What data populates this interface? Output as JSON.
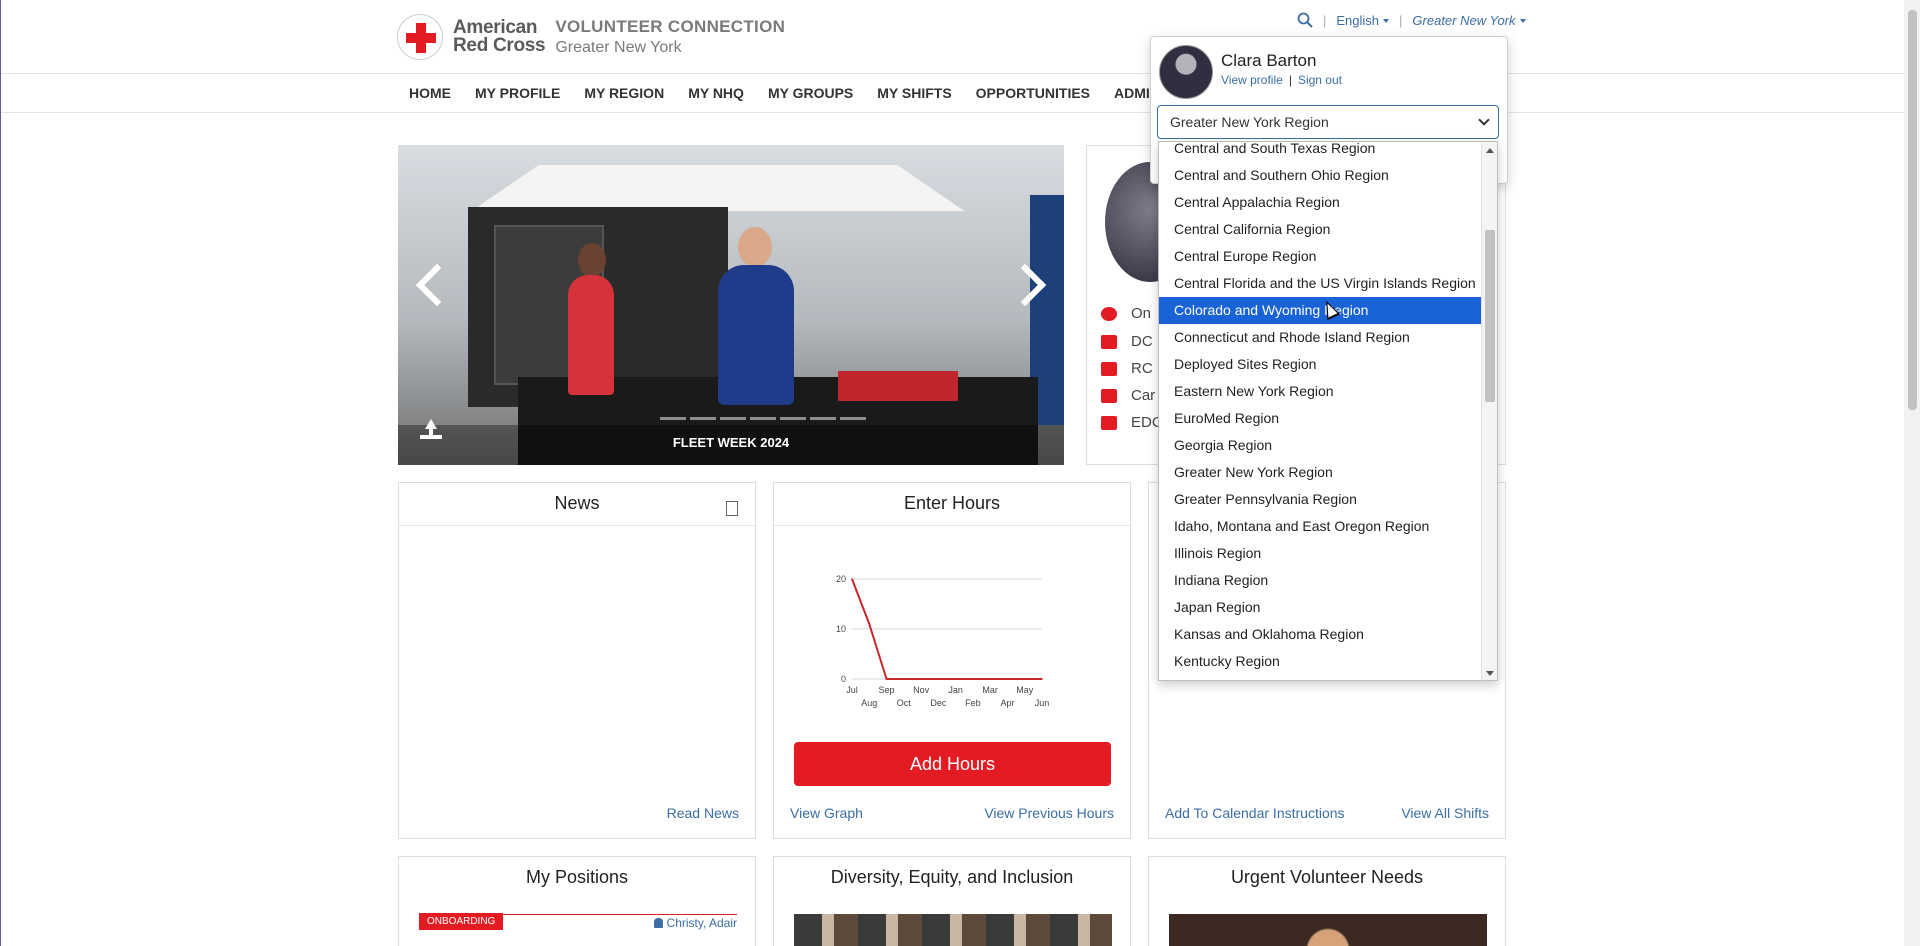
{
  "header": {
    "logo_line1": "American",
    "logo_line2": "Red Cross",
    "app_name": "VOLUNTEER CONNECTION",
    "region_name": "Greater New York",
    "language": "English",
    "region_switcher": "Greater New York"
  },
  "nav": {
    "items": [
      "HOME",
      "MY PROFILE",
      "MY REGION",
      "MY NHQ",
      "MY GROUPS",
      "MY SHIFTS",
      "OPPORTUNITIES",
      "ADMIN"
    ]
  },
  "carousel": {
    "caption": "FLEET WEEK 2024"
  },
  "profile_card": {
    "rows": [
      "On",
      "DC",
      "RC",
      "Car",
      "EDC"
    ]
  },
  "news": {
    "title": "News",
    "link": "Read News"
  },
  "hours": {
    "title": "Enter Hours",
    "button": "Add Hours",
    "link_graph": "View Graph",
    "link_previous": "View Previous Hours"
  },
  "shifts": {
    "link_calendar": "Add To Calendar Instructions",
    "link_all": "View All Shifts"
  },
  "positions": {
    "title": "My Positions",
    "badge": "ONBOARDING",
    "user": "Christy, Adair"
  },
  "dei": {
    "title": "Diversity, Equity, and Inclusion"
  },
  "urgent": {
    "title": "Urgent Volunteer Needs"
  },
  "popover": {
    "name": "Clara Barton",
    "view_profile": "View profile",
    "separator": "|",
    "sign_out": "Sign out",
    "selected_region": "Greater New York Region"
  },
  "region_dropdown": {
    "items": [
      "Central and South Texas Region",
      "Central and Southern Ohio Region",
      "Central Appalachia Region",
      "Central California Region",
      "Central Europe Region",
      "Central Florida and the US Virgin Islands Region",
      "Colorado and Wyoming Region",
      "Connecticut and Rhode Island Region",
      "Deployed Sites Region",
      "Eastern New York Region",
      "EuroMed Region",
      "Georgia Region",
      "Greater New York Region",
      "Greater Pennsylvania Region",
      "Idaho, Montana and East Oregon Region",
      "Illinois Region",
      "Indiana Region",
      "Japan Region",
      "Kansas and Oklahoma Region",
      "Kentucky Region",
      "Kentucky Region"
    ],
    "highlighted": "Colorado and Wyoming Region"
  },
  "colors": {
    "brand_red": "#e31b23",
    "link_blue": "#3b6ea5",
    "highlight_blue": "#1a63d6"
  },
  "chart_data": {
    "type": "line",
    "x_ticks_top": [
      "Jul",
      "Sep",
      "Nov",
      "Jan",
      "Mar",
      "May"
    ],
    "x_ticks_bottom": [
      "Aug",
      "Oct",
      "Dec",
      "Feb",
      "Apr",
      "Jun"
    ],
    "categories": [
      "Jul",
      "Aug",
      "Sep",
      "Oct",
      "Nov",
      "Dec",
      "Jan",
      "Feb",
      "Mar",
      "Apr",
      "May",
      "Jun"
    ],
    "values": [
      20,
      11,
      0,
      0,
      0,
      0,
      0,
      0,
      0,
      0,
      0,
      0
    ],
    "y_ticks": [
      0,
      10,
      20
    ],
    "ylim": [
      0,
      20
    ],
    "grid": true,
    "color": "#c62828"
  }
}
